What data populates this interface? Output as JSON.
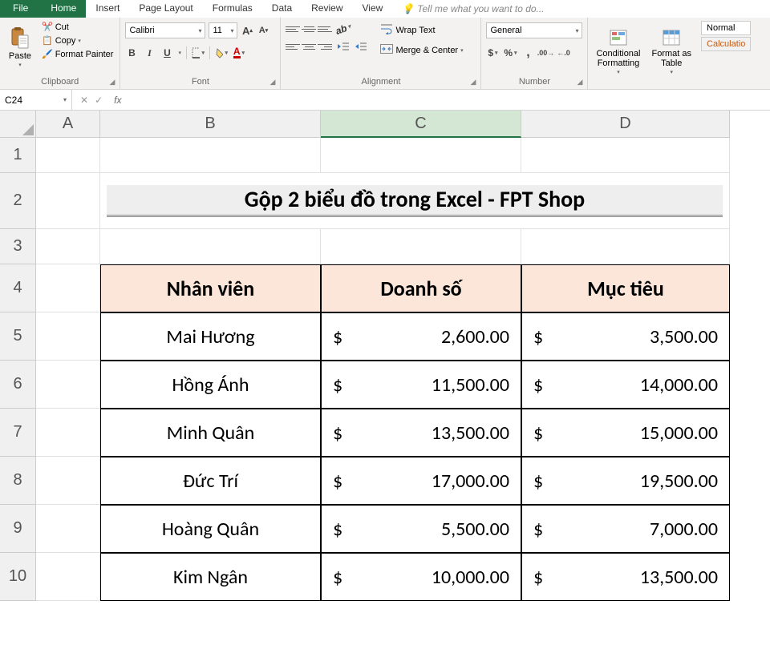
{
  "tabs": {
    "file": "File",
    "items": [
      "Home",
      "Insert",
      "Page Layout",
      "Formulas",
      "Data",
      "Review",
      "View"
    ],
    "active": "Home",
    "tell": "Tell me what you want to do..."
  },
  "ribbon": {
    "clipboard": {
      "paste": "Paste",
      "cut": "Cut",
      "copy": "Copy",
      "painter": "Format Painter",
      "label": "Clipboard"
    },
    "font": {
      "name": "Calibri",
      "size": "11",
      "label": "Font"
    },
    "alignment": {
      "wrap": "Wrap Text",
      "merge": "Merge & Center",
      "label": "Alignment"
    },
    "number": {
      "format": "General",
      "label": "Number"
    },
    "styles": {
      "cond": "Conditional\nFormatting",
      "table": "Format as\nTable",
      "normal": "Normal",
      "calc": "Calculatio"
    }
  },
  "fbar": {
    "name": "C24",
    "fx": "fx"
  },
  "columns": [
    "A",
    "B",
    "C",
    "D"
  ],
  "rows": [
    "1",
    "2",
    "3",
    "4",
    "5",
    "6",
    "7",
    "8",
    "9",
    "10"
  ],
  "title": "Gộp 2 biểu đồ trong Excel - FPT Shop",
  "headers": {
    "b": "Nhân viên",
    "c": "Doanh số",
    "d": "Mục tiêu"
  },
  "currency": "$",
  "data": [
    {
      "name": "Mai Hương",
      "c": "2,600.00",
      "d": "3,500.00"
    },
    {
      "name": "Hồng Ánh",
      "c": "11,500.00",
      "d": "14,000.00"
    },
    {
      "name": "Minh Quân",
      "c": "13,500.00",
      "d": "15,000.00"
    },
    {
      "name": "Đức Trí",
      "c": "17,000.00",
      "d": "19,500.00"
    },
    {
      "name": "Hoàng Quân",
      "c": "5,500.00",
      "d": "7,000.00"
    },
    {
      "name": "Kim Ngân",
      "c": "10,000.00",
      "d": "13,500.00"
    }
  ]
}
